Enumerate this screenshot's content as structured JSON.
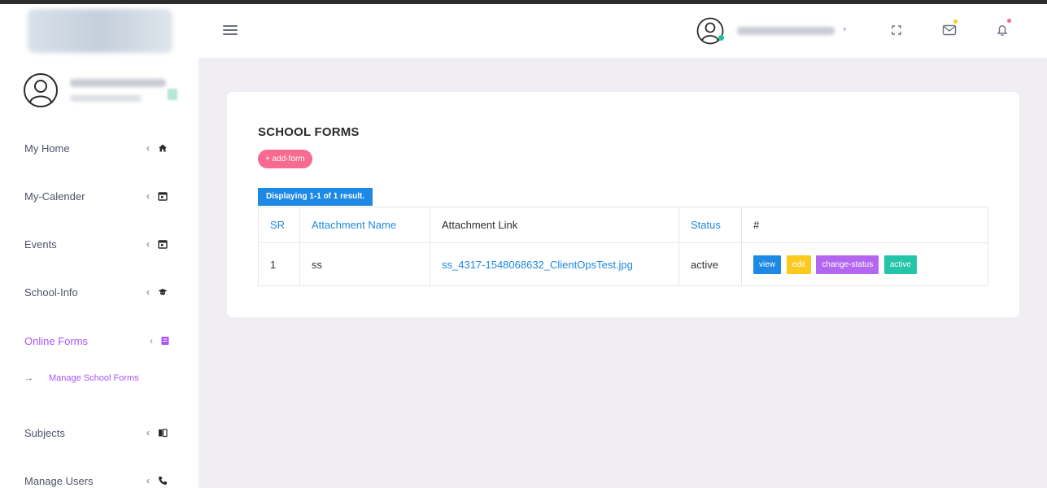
{
  "sidebar": {
    "items": [
      {
        "label": "My Home",
        "icon": "home-icon"
      },
      {
        "label": "My-Calender",
        "icon": "calendar-icon"
      },
      {
        "label": "Events",
        "icon": "calendar-icon"
      },
      {
        "label": "School-Info",
        "icon": "graduation-cap-icon"
      },
      {
        "label": "Online Forms",
        "icon": "form-icon",
        "active": true
      },
      {
        "label": "Subjects",
        "icon": "book-icon"
      },
      {
        "label": "Manage Users",
        "icon": "phone-icon"
      }
    ],
    "subitems": [
      {
        "label": "Manage School Forms"
      }
    ]
  },
  "page": {
    "title": "SCHOOL FORMS",
    "add_button": "+ add-form",
    "summary": "Displaying 1-1 of 1 result."
  },
  "table": {
    "headers": [
      "SR",
      "Attachment Name",
      "Attachment Link",
      "Status",
      "#"
    ],
    "rows": [
      {
        "sr": "1",
        "name": "ss",
        "link": "ss_4317-1548068632_ClientOpsTest.jpg",
        "status": "active",
        "actions": [
          "view",
          "edit",
          "change-status",
          "active"
        ]
      }
    ]
  },
  "colors": {
    "accent": "#1e88e5",
    "active_nav": "#a855f7",
    "add_button": "#f66b8f",
    "edit": "#fcc91e",
    "change_status": "#b366f0",
    "active_action": "#24c4a8"
  }
}
